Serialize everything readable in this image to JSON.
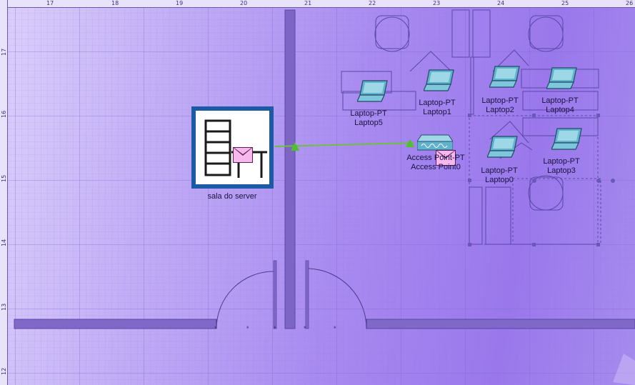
{
  "ruler": {
    "top_ticks": [
      "17",
      "18",
      "19",
      "20",
      "21",
      "22",
      "23",
      "24",
      "25",
      "26"
    ],
    "left_ticks": [
      "17",
      "16",
      "15",
      "14",
      "13",
      "12"
    ]
  },
  "server_room": {
    "label": "sala do server",
    "icon": "server-room-icon"
  },
  "access_point": {
    "line1": "Access Point-PT",
    "line2": "Access Point0"
  },
  "laptops": [
    {
      "id": "laptop5",
      "type": "Laptop-PT",
      "name": "Laptop5"
    },
    {
      "id": "laptop1",
      "type": "Laptop-PT",
      "name": "Laptop1"
    },
    {
      "id": "laptop2",
      "type": "Laptop-PT",
      "name": "Laptop2"
    },
    {
      "id": "laptop4",
      "type": "Laptop-PT",
      "name": "Laptop4"
    },
    {
      "id": "laptop0",
      "type": "Laptop-PT",
      "name": "Laptop0"
    },
    {
      "id": "laptop3",
      "type": "Laptop-PT",
      "name": "Laptop3"
    }
  ],
  "colors": {
    "link": "#6fbf3a",
    "wall": "#6a58b8",
    "server_frame": "#1c5aa6",
    "envelope": "#f7b8ee"
  },
  "pdu_icon": "envelope-icon"
}
